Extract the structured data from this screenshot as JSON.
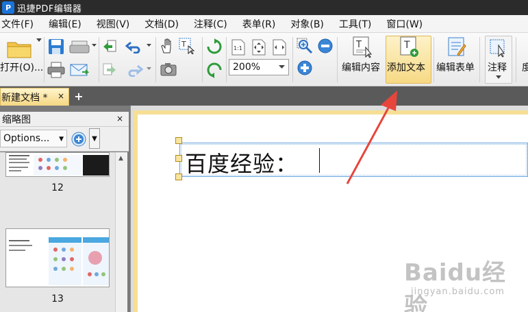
{
  "app": {
    "title": "迅捷PDF编辑器",
    "icon_letter": "P"
  },
  "menu": {
    "items": [
      "文件(F)",
      "编辑(E)",
      "视图(V)",
      "文档(D)",
      "注释(C)",
      "表单(R)",
      "对象(B)",
      "工具(T)",
      "窗口(W)"
    ]
  },
  "toolbar": {
    "open_label": "打开(O)...",
    "zoom_value": "200%",
    "edit_content_label": "编辑内容",
    "add_text_label": "添加文本",
    "edit_form_label": "编辑表单",
    "annotate_label": "注释",
    "overflow_label": "度"
  },
  "tabs": {
    "doc_tab_label": "新建文档 *",
    "close_glyph": "×",
    "new_tab_glyph": "+"
  },
  "panel": {
    "title": "缩略图",
    "close_glyph": "×",
    "options_label": "Options...",
    "thumbnails": [
      {
        "page": "12"
      },
      {
        "page": "13"
      }
    ]
  },
  "document": {
    "text": "百度经验："
  },
  "watermark": {
    "logo": "Baidu经验",
    "url": "jingyan.baidu.com"
  },
  "colors": {
    "accent": "#f6d985",
    "arrow": "#e8453c",
    "selection": "#63a3dc"
  }
}
